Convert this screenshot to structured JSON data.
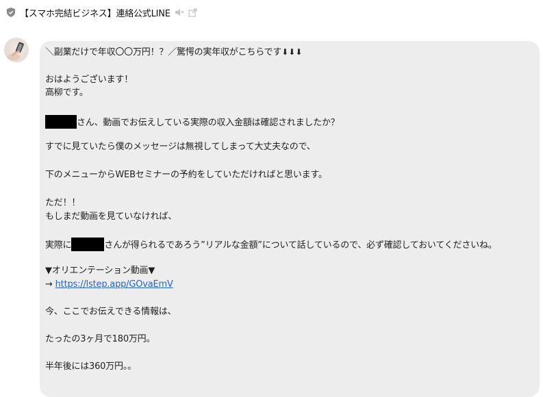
{
  "header": {
    "title": "【スマホ完結ビジネス】連絡公式LINE",
    "icons": [
      "shield-icon",
      "mute-icon",
      "external-link-icon"
    ]
  },
  "chat": {
    "avatar_icon": "avatar",
    "message": {
      "headline": "＼副業だけで年収〇〇万円！？／驚愕の実年収がこちらです",
      "headline_arrows": "⬇⬇⬇",
      "greeting": "おはようございます！",
      "name_line": "高柳です。",
      "confirm_suffix": "さん、動画でお伝えしている実際の収入金額は確認されましたか？",
      "ignore_line": "すでに見ていたら僕のメッセージは無視してしまって大丈夫なので、",
      "menu_line": "下のメニューからWEBセミナーの予約をしていただければと思います。",
      "but_line": "ただ！！",
      "not_seen_line": "もしまだ動画を見ていなければ、",
      "actual_prefix": "実際に",
      "actual_suffix": "さんが得られるであろう”リアルな金額”について話しているので、必ず確認しておいてくださいね。",
      "video_heading": "▼オリエンテーション動画▼",
      "link_arrow": "→",
      "link_url": "https://lstep.app/GOvaEmV",
      "info_line": "今、ここでお伝えできる情報は、",
      "three_months": "たったの3ヶ月で180万円。",
      "half_year": "半年後には360万円。。"
    }
  }
}
